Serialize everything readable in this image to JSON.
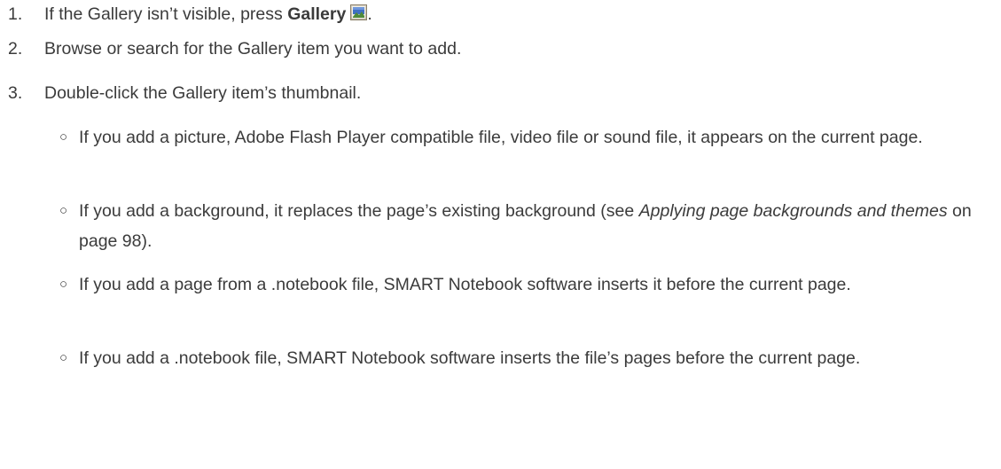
{
  "steps": [
    {
      "number": "1.",
      "text_before": "If the Gallery isn’t visible, press ",
      "bold": "Gallery",
      "icon": "gallery-icon",
      "text_after": "."
    },
    {
      "number": "2.",
      "text": "Browse or search for the Gallery item you want to add."
    },
    {
      "number": "3.",
      "text": "Double-click the Gallery item’s thumbnail."
    }
  ],
  "bullet_symbol": "○",
  "sub_items": [
    {
      "text": "If you add a picture, Adobe Flash Player compatible file, video file or sound file, it appears on the current page."
    },
    {
      "text_before": "If you add a background, it replaces the page’s existing background (see ",
      "italic": "Applying page backgrounds and themes",
      "text_after": " on page 98)."
    },
    {
      "text": "If you add a page from a .notebook file, SMART Notebook software inserts it before the current page."
    },
    {
      "text": "If you add a .notebook file, SMART Notebook software inserts the file’s pages before the current page."
    }
  ],
  "colors": {
    "text": "#3b3b3b",
    "icon_frame": "#8c806a",
    "icon_sky": "#3f6fc4",
    "icon_ground": "#4f8a3a"
  }
}
